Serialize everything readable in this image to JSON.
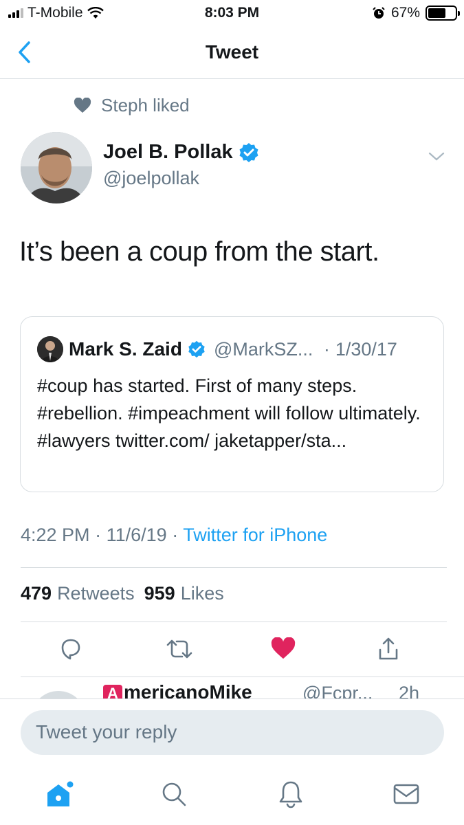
{
  "status_bar": {
    "carrier": "T-Mobile",
    "time": "8:03 PM",
    "battery_percent": "67%",
    "battery_level": 0.67,
    "icons": [
      "signal-icon",
      "wifi-icon",
      "alarm-icon",
      "battery-icon"
    ]
  },
  "nav": {
    "title": "Tweet",
    "back_icon": "chevron-left-icon"
  },
  "social_context": {
    "icon": "heart-icon",
    "text": "Steph liked"
  },
  "tweet": {
    "author_name": "Joel B. Pollak",
    "author_handle": "@joelpollak",
    "verified": true,
    "text": "It’s been a coup from the start.",
    "time": "4:22 PM",
    "date": "11/6/19",
    "source": "Twitter for iPhone",
    "retweet_count": "479",
    "retweet_label": "Retweets",
    "like_count": "959",
    "like_label": "Likes"
  },
  "quoted_tweet": {
    "author_name": "Mark S. Zaid",
    "author_handle": "@MarkSZ...",
    "date": "1/30/17",
    "verified": true,
    "text": "#coup has started. First of many steps. #rebellion. #impeachment will follow ultimately. #lawyers twitter.com/ jaketapper/sta..."
  },
  "actions": [
    {
      "name": "reply",
      "icon": "reply-icon"
    },
    {
      "name": "retweet",
      "icon": "retweet-icon"
    },
    {
      "name": "like",
      "icon": "heart-filled-icon",
      "color": "#e0245e"
    },
    {
      "name": "share",
      "icon": "share-icon"
    }
  ],
  "next_reply": {
    "name_visible": "mericanoMike",
    "handle_visible": "@Fcpr...",
    "time_visible": "2h"
  },
  "reply_box": {
    "placeholder": "Tweet your reply"
  },
  "tab_bar": [
    {
      "name": "home",
      "icon": "home-icon",
      "active": true
    },
    {
      "name": "search",
      "icon": "search-icon"
    },
    {
      "name": "notifications",
      "icon": "bell-icon"
    },
    {
      "name": "messages",
      "icon": "mail-icon"
    }
  ],
  "colors": {
    "accent": "#1da1f2",
    "like": "#e0245e",
    "secondary_text": "#657786",
    "border": "#d8dde1"
  }
}
